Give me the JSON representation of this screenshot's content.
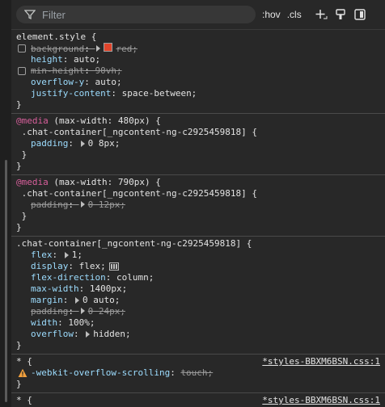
{
  "toolbar": {
    "filter_placeholder": "Filter",
    "hov_label": ":hov",
    "cls_label": ".cls",
    "icons": [
      "filter-icon",
      "add-rule-icon",
      "format-painter-icon",
      "toggle-sidebar-icon"
    ]
  },
  "rules": {
    "element_style": {
      "selector": "element.style {",
      "props": [
        {
          "name": "background",
          "value": "red;",
          "struck": true,
          "checkbox": true,
          "swatch": "#e0442b"
        },
        {
          "name": "height",
          "value": "auto;"
        },
        {
          "name": "min-height",
          "value": "90vh;",
          "struck": true,
          "checkbox": true
        },
        {
          "name": "overflow-y",
          "value": "auto;"
        },
        {
          "name": "justify-content",
          "value": "space-between;"
        }
      ],
      "close": "}"
    },
    "media480": {
      "at": "@media",
      "query": " (max-width: 480px) {",
      "selector": " .chat-container[_ngcontent-ng-c2925459818] {",
      "prop_name": "padding",
      "prop_value": "0 8px;",
      "inner_close": " }",
      "outer_close": "}"
    },
    "media790": {
      "at": "@media",
      "query": " (max-width: 790px) {",
      "selector": " .chat-container[_ngcontent-ng-c2925459818] {",
      "prop_name": "padding",
      "prop_value": "0 12px;",
      "inner_close": " }",
      "outer_close": "}"
    },
    "chat_container": {
      "selector": ".chat-container[_ngcontent-ng-c2925459818] {",
      "props": {
        "flex": {
          "name": "flex",
          "value": "1;"
        },
        "display": {
          "name": "display",
          "value": "flex;"
        },
        "flex_direction": {
          "name": "flex-direction",
          "value": "column;"
        },
        "max_width": {
          "name": "max-width",
          "value": "1400px;"
        },
        "margin": {
          "name": "margin",
          "value": "0 auto;"
        },
        "padding": {
          "name": "padding",
          "value": "0 24px;"
        },
        "width": {
          "name": "width",
          "value": "100%;"
        },
        "overflow": {
          "name": "overflow",
          "value": "hidden;"
        }
      },
      "close": "}"
    },
    "star1": {
      "selector": "* {",
      "source": "*styles-BBXM6BSN.css:1",
      "prop_name": "-webkit-overflow-scrolling",
      "prop_value": "touch;"
    },
    "star2": {
      "selector": "* {",
      "source": "*styles-BBXM6BSN.css:1"
    }
  }
}
